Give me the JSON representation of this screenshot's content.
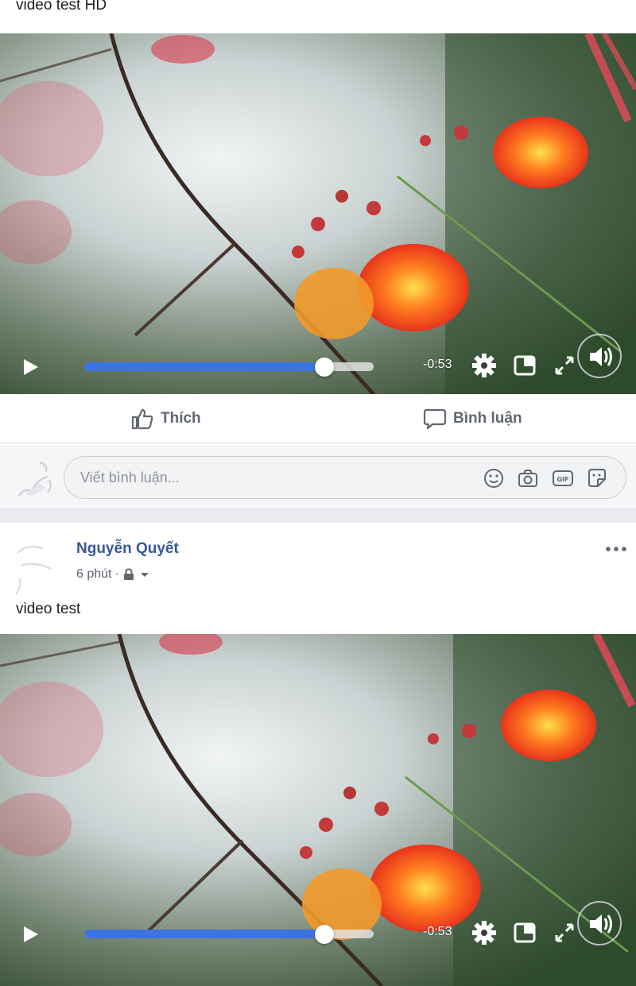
{
  "post1": {
    "text": "video test HD",
    "video": {
      "time": "-0:53",
      "progress": 0.83
    },
    "actions": {
      "like_label": "Thích",
      "comment_label": "Bình luận"
    },
    "comment_box": {
      "placeholder": "Viết bình luận..."
    }
  },
  "post2": {
    "author": "Nguyễn Quyết",
    "time": "6 phút",
    "separator": "·",
    "text": "video test",
    "video": {
      "time": "-0:53",
      "progress": 0.83
    }
  },
  "icons": {
    "play": "play-icon",
    "settings": "gear-icon",
    "pip": "picture-in-picture-icon",
    "fullscreen": "expand-icon",
    "volume": "speaker-icon",
    "like": "thumbs-up-icon",
    "comment": "speech-bubble-icon",
    "emoji": "smiley-icon",
    "camera": "camera-icon",
    "gif": "gif-icon",
    "sticker": "sticker-icon",
    "privacy": "lock-icon",
    "more": "ellipsis-icon"
  },
  "colors": {
    "accent": "#3b74e0",
    "link": "#385898",
    "muted": "#606770"
  }
}
